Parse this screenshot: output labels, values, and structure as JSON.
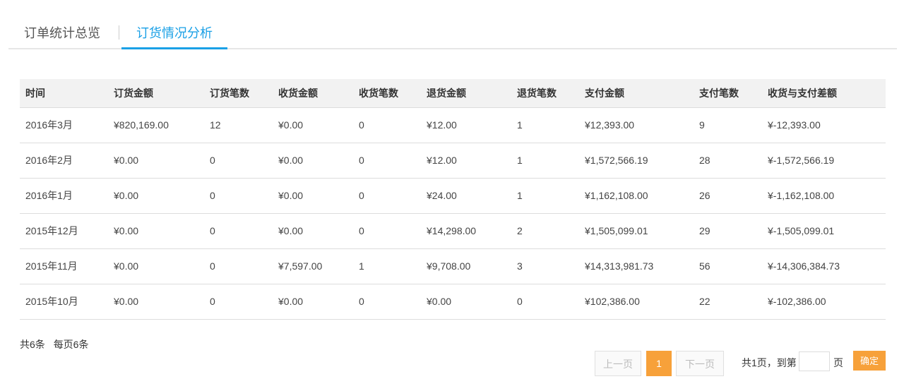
{
  "tabs": [
    {
      "label": "订单统计总览",
      "active": false
    },
    {
      "label": "订货情况分析",
      "active": true
    }
  ],
  "table": {
    "headers": [
      "时间",
      "订货金额",
      "订货笔数",
      "收货金额",
      "收货笔数",
      "退货金额",
      "退货笔数",
      "支付金额",
      "支付笔数",
      "收货与支付差额"
    ],
    "rows": [
      [
        "2016年3月",
        "¥820,169.00",
        "12",
        "¥0.00",
        "0",
        "¥12.00",
        "1",
        "¥12,393.00",
        "9",
        "¥-12,393.00"
      ],
      [
        "2016年2月",
        "¥0.00",
        "0",
        "¥0.00",
        "0",
        "¥12.00",
        "1",
        "¥1,572,566.19",
        "28",
        "¥-1,572,566.19"
      ],
      [
        "2016年1月",
        "¥0.00",
        "0",
        "¥0.00",
        "0",
        "¥24.00",
        "1",
        "¥1,162,108.00",
        "26",
        "¥-1,162,108.00"
      ],
      [
        "2015年12月",
        "¥0.00",
        "0",
        "¥0.00",
        "0",
        "¥14,298.00",
        "2",
        "¥1,505,099.01",
        "29",
        "¥-1,505,099.01"
      ],
      [
        "2015年11月",
        "¥0.00",
        "0",
        "¥7,597.00",
        "1",
        "¥9,708.00",
        "3",
        "¥14,313,981.73",
        "56",
        "¥-14,306,384.73"
      ],
      [
        "2015年10月",
        "¥0.00",
        "0",
        "¥0.00",
        "0",
        "¥0.00",
        "0",
        "¥102,386.00",
        "22",
        "¥-102,386.00"
      ]
    ]
  },
  "summary": {
    "total": "共6条",
    "per_page": "每页6条"
  },
  "pager": {
    "prev": "上一页",
    "current": "1",
    "next": "下一页",
    "total_pages": "共1页，到第",
    "goto_value": "",
    "unit": "页",
    "confirm": "确定"
  },
  "colors": {
    "accent": "#1aa0e6",
    "pager_active": "#f7a13a"
  }
}
